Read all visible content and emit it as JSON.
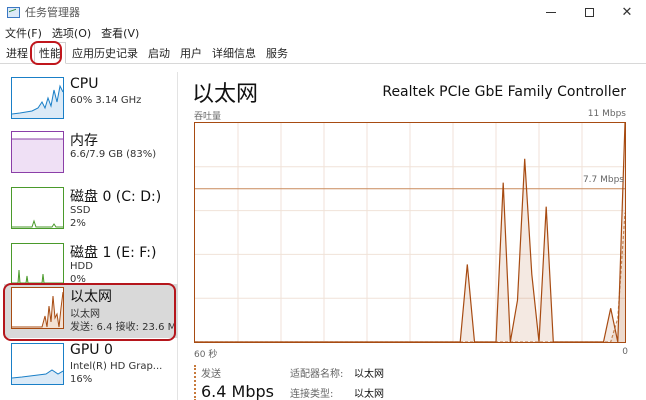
{
  "window": {
    "title": "任务管理器",
    "controls": {
      "minimize": "minimize-icon",
      "maximize": "maximize-icon",
      "close": "close-icon"
    }
  },
  "menu": [
    "文件(F)",
    "选项(O)",
    "查看(V)"
  ],
  "tabs": [
    {
      "label": "进程",
      "active": false
    },
    {
      "label": "性能",
      "active": true
    },
    {
      "label": "应用历史记录",
      "active": false
    },
    {
      "label": "启动",
      "active": false
    },
    {
      "label": "用户",
      "active": false
    },
    {
      "label": "详细信息",
      "active": false
    },
    {
      "label": "服务",
      "active": false
    }
  ],
  "sidebar": {
    "items": [
      {
        "title": "CPU",
        "sub1": "60% 3.14 GHz",
        "sub2": "",
        "color": "#1a7fc7"
      },
      {
        "title": "内存",
        "sub1": "6.6/7.9 GB (83%)",
        "sub2": "",
        "color": "#8b3fa8"
      },
      {
        "title": "磁盘 0 (C: D:)",
        "sub1": "SSD",
        "sub2": "2%",
        "color": "#4a9a2b"
      },
      {
        "title": "磁盘 1 (E: F:)",
        "sub1": "HDD",
        "sub2": "0%",
        "color": "#4a9a2b"
      },
      {
        "title": "以太网",
        "sub1": "以太网",
        "sub2": "发送: 6.4 接收: 23.6 M",
        "color": "#a74b12"
      },
      {
        "title": "GPU 0",
        "sub1": "Intel(R) HD Grap...",
        "sub2": "16%",
        "color": "#1a7fc7"
      }
    ]
  },
  "main": {
    "title": "以太网",
    "adapter": "Realtek PCIe GbE Family Controller",
    "graph_label": "吞吐量",
    "graph_max": "11 Mbps",
    "scale_line": "7.7 Mbps",
    "axis_left": "60 秒",
    "axis_right": "0",
    "send_label": "发送",
    "send_value": "6.4 Mbps",
    "props": [
      {
        "key": "适配器名称:",
        "value": "以太网"
      },
      {
        "key": "连接类型:",
        "value": "以太网"
      }
    ]
  },
  "colors": {
    "accent": "#a74b12",
    "highlight": "#c0161c"
  },
  "chart_data": {
    "type": "line",
    "ylim": [
      0,
      11
    ],
    "y_unit": "Mbps",
    "x_range_seconds": [
      60,
      0
    ],
    "series": [
      {
        "values": [
          0,
          0,
          0,
          0,
          0,
          0,
          0,
          0,
          0,
          0,
          0,
          0,
          0,
          0,
          0,
          0,
          0,
          0,
          0,
          0,
          0,
          0,
          0,
          0,
          0,
          0,
          0,
          0,
          0,
          0,
          0,
          0,
          0,
          0,
          0,
          0,
          0,
          0,
          0,
          0,
          0,
          0,
          0,
          0,
          0,
          0,
          0,
          0,
          0,
          0,
          0,
          0,
          0,
          0,
          0,
          0,
          0,
          0,
          0,
          1.2,
          6.5
        ]
      },
      {
        "values": [
          0,
          0,
          0,
          0,
          0,
          0,
          0,
          0,
          0,
          0,
          0,
          0,
          0,
          0,
          0,
          0,
          0,
          0,
          0,
          0,
          0,
          0,
          0,
          0,
          0,
          0,
          0,
          0,
          0,
          0,
          0,
          0,
          0,
          0,
          0,
          0,
          0,
          0,
          3.9,
          0,
          0,
          0,
          0,
          8.0,
          0,
          2.1,
          9.2,
          3.4,
          0,
          6.8,
          0,
          0,
          0,
          0,
          0,
          0,
          0,
          0,
          1.7,
          0,
          11
        ]
      }
    ]
  }
}
